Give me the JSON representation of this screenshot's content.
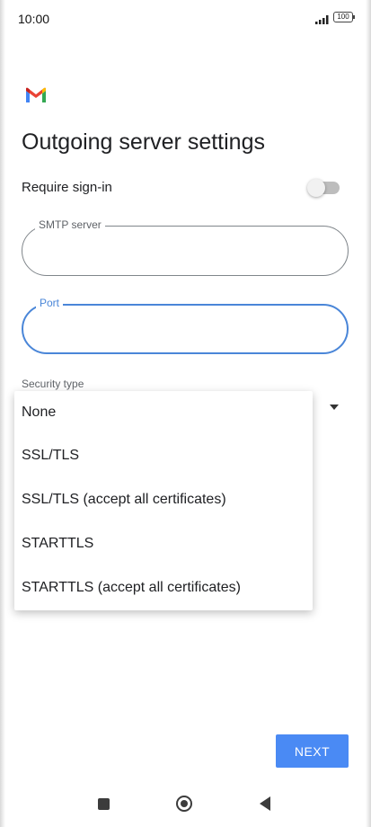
{
  "status_bar": {
    "time": "10:00",
    "battery": "100"
  },
  "app": {
    "logo_icon": "gmail-logo-icon",
    "title": "Outgoing server settings"
  },
  "form": {
    "require_signin_label": "Require sign-in",
    "require_signin_enabled": false,
    "smtp_label": "SMTP server",
    "smtp_value": "",
    "port_label": "Port",
    "port_value": "",
    "security_type_label": "Security type"
  },
  "security_menu": {
    "options": [
      "None",
      "SSL/TLS",
      "SSL/TLS (accept all certificates)",
      "STARTTLS",
      "STARTTLS (accept all certificates)"
    ]
  },
  "actions": {
    "next_label": "NEXT"
  },
  "nav": {
    "recents_icon": "square-icon",
    "home_icon": "circle-icon",
    "back_icon": "triangle-back-icon"
  },
  "colors": {
    "accent": "#4a8af4",
    "focus_border": "#4a86d8"
  }
}
